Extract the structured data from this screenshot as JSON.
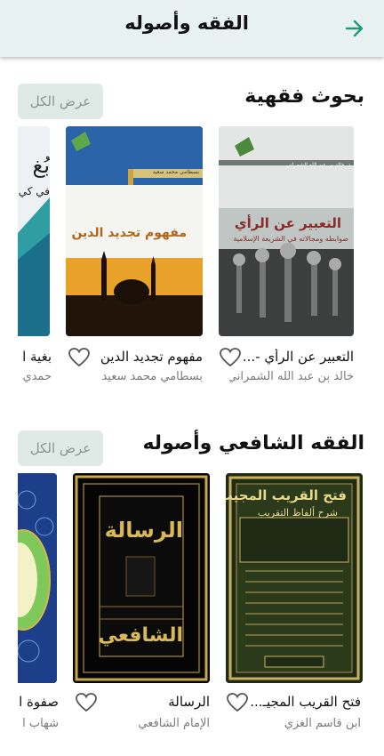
{
  "header": {
    "title": "الفقه وأصوله",
    "back_icon": "arrow-right-icon",
    "accent": "#1f9a7a"
  },
  "sections": [
    {
      "title": "بحوث فقهية",
      "view_all": "عرض الكل",
      "books": [
        {
          "title": "التعبير عن الرأي -...",
          "author": "خالد بن عبد الله الشمراني",
          "cover_title": "التعبير عن الرأي",
          "cover_sub": "ضوابطه ومجالاته في الشريعة الإسلامية",
          "cover_author": "د. خالد بن عبد الله الشمراني"
        },
        {
          "title": "مفهوم تجديد الدين",
          "author": "بسطامي محمد سعيد",
          "cover_title": "مفهوم تجديد الدين",
          "cover_author": "بسطامي محمد سعيد"
        },
        {
          "title": "بغية ا",
          "author": "حمدي",
          "cover_title": "بُغ",
          "cover_sub": "في كي"
        }
      ]
    },
    {
      "title": "الفقه الشافعي وأصوله",
      "view_all": "عرض الكل",
      "books": [
        {
          "title": "فتح القريب المجيـ...",
          "author": "ابن قاسم الغزي",
          "cover_title": "فتح القريب المجيب",
          "cover_sub": "شرح ألفاظ التقريب"
        },
        {
          "title": "الرسالة",
          "author": "الإمام الشافعي",
          "cover_title": "الرسالة",
          "cover_sub": "الشافعي"
        },
        {
          "title": "صفوة ا",
          "author": "شهاب ا"
        }
      ]
    }
  ]
}
